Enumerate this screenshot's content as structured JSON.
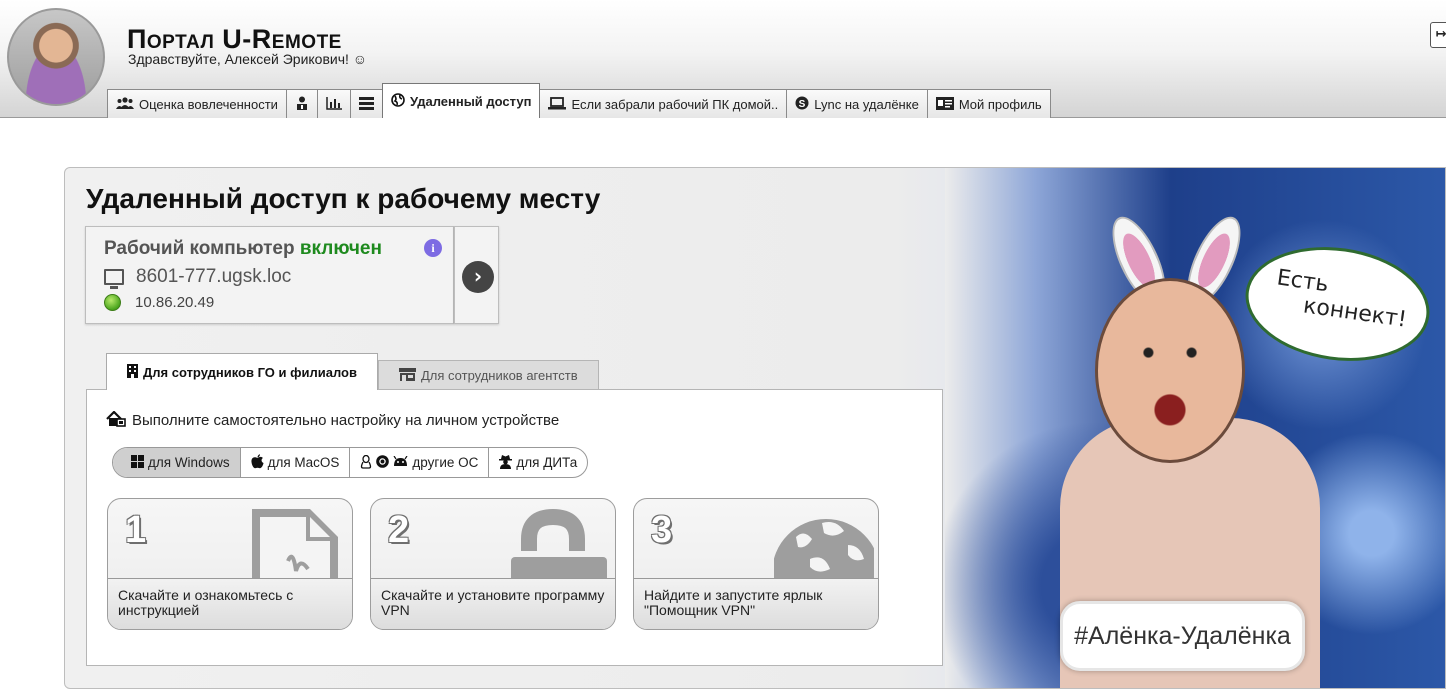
{
  "header": {
    "title": "Портал U-Remote",
    "greeting": "Здравствуйте, Алексей Эрикович! ☺",
    "logout_icon": "logout-icon",
    "tabs": [
      {
        "label": "Оценка вовлеченности",
        "icon": "users-icon"
      },
      {
        "label": "",
        "icon": "org-person-icon"
      },
      {
        "label": "",
        "icon": "bar-chart-icon"
      },
      {
        "label": "",
        "icon": "list-icon"
      },
      {
        "label": "Удаленный доступ",
        "icon": "globe-icon",
        "active": true
      },
      {
        "label": "Если забрали рабочий ПК домой..",
        "icon": "laptop-icon"
      },
      {
        "label": "Lync на удалёнке",
        "icon": "skype-icon"
      },
      {
        "label": "Мой профиль",
        "icon": "id-card-icon"
      }
    ]
  },
  "main": {
    "heading": "Удаленный доступ к рабочему месту",
    "computer": {
      "title_prefix": "Рабочий компьютер",
      "status": "включен",
      "hostname": "8601-777.ugsk.loc",
      "ip": "10.86.20.49",
      "status_color": "#1e8a1e"
    },
    "subtabs": [
      {
        "label": "Для сотрудников ГО и филиалов",
        "active": true
      },
      {
        "label": "Для сотрудников агентств",
        "active": false
      }
    ],
    "instruction": "Выполните самостоятельно настройку на личном устройстве",
    "os_options": [
      {
        "label": "для Windows",
        "active": true
      },
      {
        "label": "для MacOS",
        "active": false
      },
      {
        "label": "другие ОС",
        "active": false
      },
      {
        "label": "для ДИТа",
        "active": false
      }
    ],
    "steps": [
      {
        "number": "1",
        "caption": "Скачайте и ознакомьтесь с инструкцией",
        "icon": "pdf-file-icon"
      },
      {
        "number": "2",
        "caption": "Скачайте и установите программу VPN",
        "icon": "lock-icon"
      },
      {
        "number": "3",
        "caption": "Найдите и запустите ярлык \"Помощник VPN\"",
        "icon": "globe-icon"
      }
    ]
  },
  "promo": {
    "speech_line1": "Есть",
    "speech_line2": "коннект!",
    "hashtag": "#Алёнка-Удалёнка"
  }
}
